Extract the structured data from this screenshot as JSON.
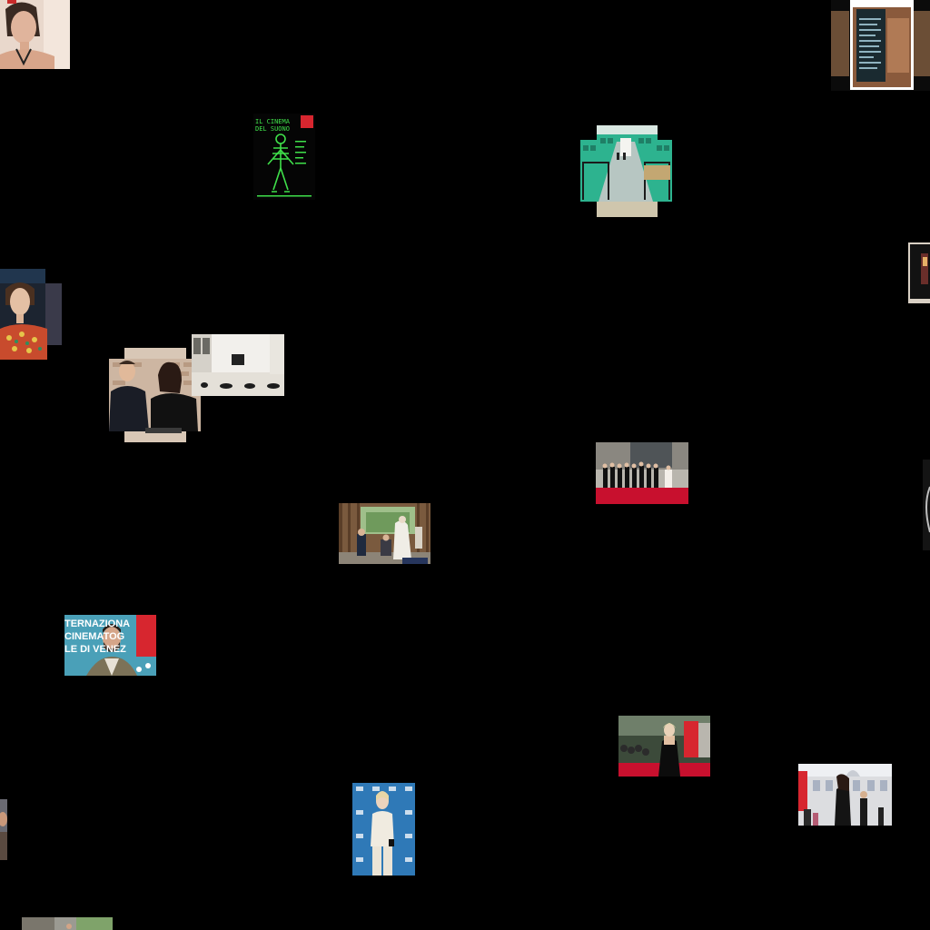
{
  "gallery": {
    "tiles": [
      {
        "name": "portrait-woman-top-left",
        "alt": "Portrait of a woman with dark hair"
      },
      {
        "name": "cinema-program-board",
        "alt": "Cinema program board"
      },
      {
        "name": "poster-il-cinema-del-suono",
        "alt": "Poster with green skeleton figure"
      },
      {
        "name": "green-exhibition-hall",
        "alt": "Exhibition hall with green walls"
      },
      {
        "name": "dark-edge-right-tile",
        "alt": "Partial dark image at right edge"
      },
      {
        "name": "portrait-woman-colorful-dress",
        "alt": "Woman in colorful embroidered dress"
      },
      {
        "name": "two-people-brick-wall",
        "alt": "Man and woman in front of brick wall"
      },
      {
        "name": "white-room-installation",
        "alt": "White room with black objects on floor"
      },
      {
        "name": "group-red-carpet",
        "alt": "Group photo on red carpet"
      },
      {
        "name": "garden-pavilion-scene",
        "alt": "People in a wooden garden pavilion"
      },
      {
        "name": "man-photocall-venice",
        "alt": "Man at photocall backdrop"
      },
      {
        "name": "woman-black-dress-red-carpet",
        "alt": "Woman in black dress on red carpet"
      },
      {
        "name": "woman-white-dress-photocall",
        "alt": "Woman in white outfit at photocall"
      },
      {
        "name": "woman-palazzo-red-carpet",
        "alt": "Woman posing in front of palazzo"
      },
      {
        "name": "partial-left-edge-tile",
        "alt": "Partial image at left edge"
      },
      {
        "name": "partial-bottom-tile",
        "alt": "Partial image at bottom edge"
      },
      {
        "name": "partial-right-edge-tile",
        "alt": "Partial image at right edge"
      }
    ],
    "texts": {
      "cinema_board_label": "CINEMA",
      "poster_title_line1": "IL CINEMA",
      "poster_title_line2": "DEL SUONO",
      "photocall_line1": "TERNAZIONA",
      "photocall_line2": "CINEMATOG",
      "photocall_line3": "LE DI VENEZ"
    },
    "colors": {
      "background": "#000000",
      "venice_red": "#d7262f",
      "photocall_blue": "#2f79b7",
      "poster_green": "#3fe04a",
      "exhibition_green": "#2db38f",
      "red_carpet": "#c8102e"
    }
  }
}
